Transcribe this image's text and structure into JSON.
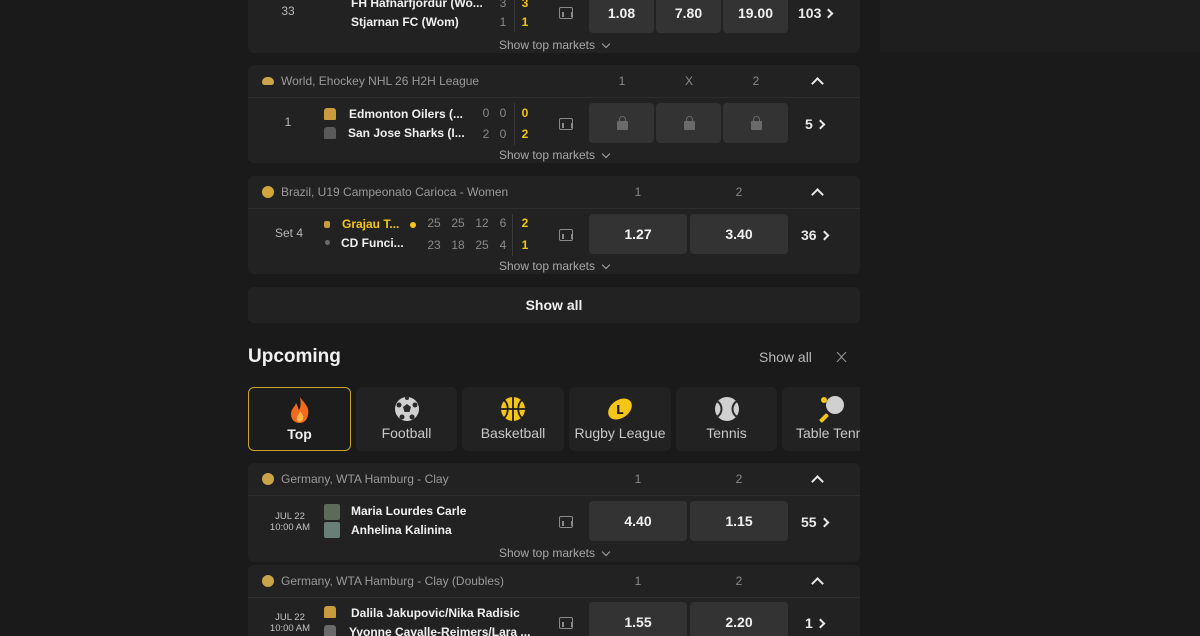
{
  "colors": {
    "accent": "#f5c518",
    "card": "#222222",
    "odd": "#333333",
    "bg": "#1a1a1a"
  },
  "event0": {
    "minute": "33",
    "team1": "FH Hafnarfjordur (Wo...",
    "team2": "Stjarnan FC (Wom)",
    "scores1": [
      "3",
      "3"
    ],
    "scores2": [
      "1",
      "1"
    ],
    "odds": [
      "1.08",
      "7.80",
      "19.00"
    ],
    "markets": "103",
    "top_markets": "Show top markets"
  },
  "league1": {
    "name": "World, Ehockey NHL 26 H2H League",
    "cols": [
      "1",
      "X",
      "2"
    ],
    "icon": "hockey-icon",
    "event": {
      "period": "1",
      "team1": "Edmonton Oilers (...",
      "team2": "San Jose Sharks (I...",
      "scores1": [
        "0",
        "0",
        "0"
      ],
      "scores2": [
        "2",
        "0",
        "2"
      ],
      "markets": "5",
      "top_markets": "Show top markets"
    }
  },
  "league2": {
    "name": "Brazil, U19 Campeonato Carioca - Women",
    "cols": [
      "1",
      "2"
    ],
    "icon": "volleyball-icon",
    "event": {
      "period": "Set 4",
      "team1": "Grajau T...",
      "team2": "CD Funci...",
      "scores1": [
        "25",
        "25",
        "12",
        "6",
        "2"
      ],
      "scores2": [
        "23",
        "18",
        "25",
        "4",
        "1"
      ],
      "odds": [
        "1.27",
        "3.40"
      ],
      "markets": "36",
      "top_markets": "Show top markets"
    }
  },
  "show_all_button": "Show all",
  "upcoming": {
    "title": "Upcoming",
    "show_all": "Show all",
    "tabs": [
      {
        "label": "Top",
        "icon": "flame-icon"
      },
      {
        "label": "Football",
        "icon": "football-icon"
      },
      {
        "label": "Basketball",
        "icon": "basketball-icon"
      },
      {
        "label": "Rugby League",
        "icon": "rugby-icon"
      },
      {
        "label": "Tennis",
        "icon": "tennis-icon"
      },
      {
        "label": "Table Tennis",
        "icon": "table-tennis-icon"
      }
    ]
  },
  "league3": {
    "name": "Germany, WTA Hamburg - Clay",
    "cols": [
      "1",
      "2"
    ],
    "icon": "tennis-ball-icon",
    "event": {
      "date": "JUL 22",
      "time": "10:00 AM",
      "team1": "Maria Lourdes Carle",
      "team2": "Anhelina Kalinina",
      "odds": [
        "4.40",
        "1.15"
      ],
      "markets": "55",
      "top_markets": "Show top markets"
    }
  },
  "league4": {
    "name": "Germany, WTA Hamburg - Clay (Doubles)",
    "cols": [
      "1",
      "2"
    ],
    "icon": "tennis-ball-icon",
    "event": {
      "date": "JUL 22",
      "time": "10:00 AM",
      "team1": "Dalila Jakupovic/Nika Radisic",
      "team2": "Yvonne Cavalle-Reimers/Lara ...",
      "odds": [
        "1.55",
        "2.20"
      ],
      "markets": "1"
    }
  }
}
